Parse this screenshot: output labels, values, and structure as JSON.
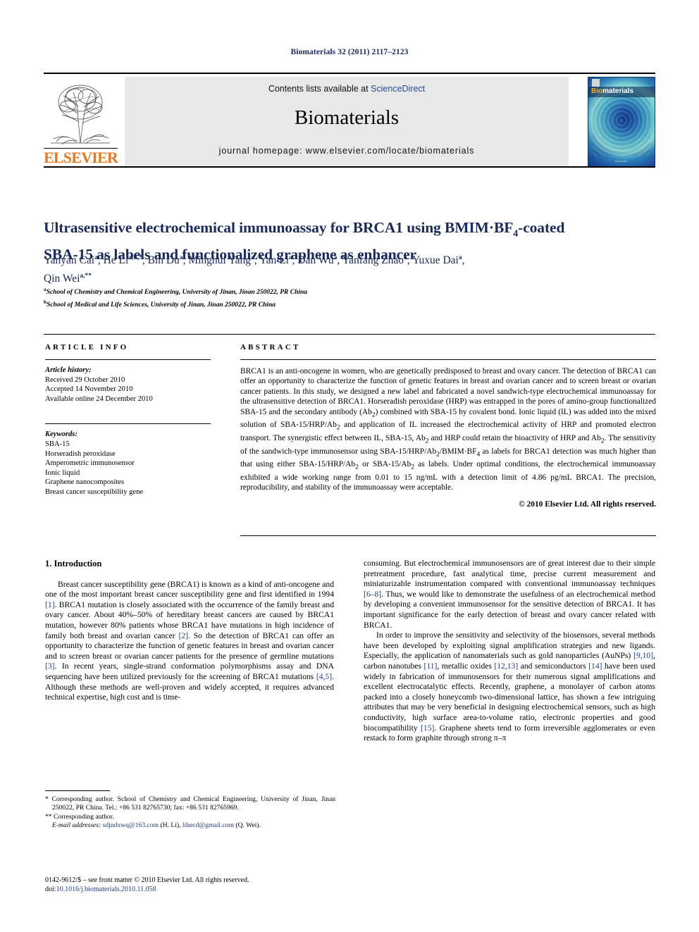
{
  "running_head": "Biomaterials 32 (2011) 2117–2123",
  "masthead": {
    "contents_prefix": "Contents lists available at ",
    "contents_link": "ScienceDirect",
    "journal_title": "Biomaterials",
    "homepage": "journal homepage: www.elsevier.com/locate/biomaterials",
    "publisher_name": "ELSEVIER",
    "publisher_logo_icon": "elsevier-tree-logo",
    "cover": {
      "wordmark_prefix": "Bio",
      "wordmark_suffix": "materials",
      "footer": "Elsevier"
    }
  },
  "article": {
    "title_line1_a": "Ultrasensitive electrochemical immunoassay for BRCA1 using BMIM",
    "title_line1_b": "BF",
    "title_line1_sub": "4",
    "title_line1_c": "-coated",
    "title_line2": "SBA-15 as labels and functionalized graphene as enhancer",
    "authors": "Yanyan Cai a, He Li a,b,*, Bin Du a, Minghui Yang a, Yan Li a, Dan Wu a, Yanfang Zhao a, Yuxue Dai a, Qin Wei a,**",
    "affiliation_a": "School of Chemistry and Chemical Engineering, University of Jinan, Jinan 250022, PR China",
    "affiliation_b": "School of Medical and Life Sciences, University of Jinan, Jinan 250022, PR China"
  },
  "info": {
    "heading": "ARTICLE INFO",
    "history_label": "Article history:",
    "history": [
      "Received 29 October 2010",
      "Accepted 14 November 2010",
      "Available online 24 December 2010"
    ],
    "keywords_label": "Keywords:",
    "keywords": [
      "SBA-15",
      "Horseradish peroxidase",
      "Amperometric immunosensor",
      "Ionic liquid",
      "Graphene nanocomposites",
      "Breast cancer susceptibility gene"
    ]
  },
  "abstract": {
    "heading": "ABSTRACT",
    "text": "BRCA1 is an anti-oncogene in women, who are genetically predisposed to breast and ovary cancer. The detection of BRCA1 can offer an opportunity to characterize the function of genetic features in breast and ovarian cancer and to screen breast or ovarian cancer patients. In this study, we designed a new label and fabricated a novel sandwich-type electrochemical immunoassay for the ultrasensitive detection of BRCA1. Horseradish peroxidase (HRP) was entrapped in the pores of amino-group functionalized SBA-15 and the secondary antibody (Ab2) combined with SBA-15 by covalent bond. Ionic liquid (IL) was added into the mixed solution of SBA-15/HRP/Ab2 and application of IL increased the electrochemical activity of HRP and promoted electron transport. The synergistic effect between IL, SBA-15, Ab2 and HRP could retain the bioactivity of HRP and Ab2. The sensitivity of the sandwich-type immunosensor using SBA-15/HRP/Ab2/BMIM·BF4 as labels for BRCA1 detection was much higher than that using either SBA-15/HRP/Ab2 or SBA-15/Ab2 as labels. Under optimal conditions, the electrochemical immunoassay exhibited a wide working range from 0.01 to 15 ng/mL with a detection limit of 4.86 pg/mL BRCA1. The precision, reproducibility, and stability of the immunoassay were acceptable.",
    "copyright": "© 2010 Elsevier Ltd. All rights reserved."
  },
  "body": {
    "section_number_title": "1.  Introduction",
    "left_paragraphs": [
      "Breast cancer susceptibility gene (BRCA1) is known as a kind of anti-oncogene and one of the most important breast cancer susceptibility gene and first identified in 1994 [1]. BRCA1 mutation is closely associated with the occurrence of the family breast and ovary cancer. About 40%–50% of hereditary breast cancers are caused by BRCA1 mutation, however 80% patients whose BRCA1 have mutations in high incidence of family both breast and ovarian cancer [2]. So the detection of BRCA1 can offer an opportunity to characterize the function of genetic features in breast and ovarian cancer and to screen breast or ovarian cancer patients for the presence of germline mutations [3]. In recent years, single-strand conformation polymorphisms assay and DNA sequencing have been utilized previously for the screening of BRCA1 mutations [4,5]. Although these methods are well-proven and widely accepted, it requires advanced technical expertise, high cost and is time-"
    ],
    "right_paragraphs": [
      "consuming. But electrochemical immunosensors are of great interest due to their simple pretreatment procedure, fast analytical time, precise current measurement and miniaturizable instrumentation compared with conventional immunoassay techniques [6–8]. Thus, we would like to demonstrate the usefulness of an electrochemical method by developing a convenient immunosensor for the sensitive detection of BRCA1. It has important significance for the early detection of breast and ovary cancer related with BRCA1.",
      "In order to improve the sensitivity and selectivity of the biosensors, several methods have been developed by exploiting signal amplification strategies and new ligands. Especially, the application of nanomaterials such as gold nanoparticles (AuNPs) [9,10], carbon nanotubes [11], metallic oxides [12,13] and semiconductors [14] have been used widely in fabrication of immunosensors for their numerous signal amplifications and excellent electrocatalytic effects. Recently, graphene, a monolayer of carbon atoms packed into a closely honeycomb two-dimensional lattice, has shown a few intriguing attributes that may be very beneficial in designing electrochemical sensors, such as high conductivity, high surface area-to-volume ratio, electronic properties and good biocompatibility [15]. Graphene sheets tend to form irreversible agglomerates or even restack to form graphite through strong π–π"
    ]
  },
  "footnotes": {
    "corresponding_1": "* Corresponding author. School of Chemistry and Chemical Engineering, University of Jinan, Jinan 250022, PR China. Tel.: +86 531 82765730; fax: +86 531 82765969.",
    "corresponding_2": "** Corresponding author.",
    "email_label": "E-mail addresses:",
    "email_1": "sdjndxwq@163.com",
    "email_1_person": "(H. Li),",
    "email_2": "lihecd@gmail.com",
    "email_2_person": "(Q. Wei).",
    "issn_line": "0142-9612/$ – see front matter © 2010 Elsevier Ltd. All rights reserved.",
    "doi_label": "doi:",
    "doi_value": "10.1016/j.biomaterials.2010.11.058"
  },
  "colors": {
    "heading_blue": "#1a2a5c",
    "link_blue": "#1f3d8a",
    "elsevier_orange": "#E87722",
    "banner_gray": "#e8e8e8"
  }
}
